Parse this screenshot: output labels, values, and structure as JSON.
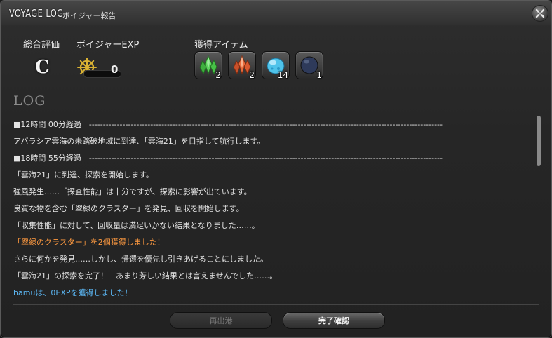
{
  "window": {
    "title": "VOYAGE LOG",
    "subtitle": "ボイジャー報告"
  },
  "summary": {
    "rating_label": "総合評価",
    "rating_value": "C",
    "exp_label": "ボイジャーEXP",
    "exp_value": "0",
    "exp_progress": 0,
    "items_label": "獲得アイテム"
  },
  "items": [
    {
      "icon": "green-crystal-cluster-icon",
      "count": "2"
    },
    {
      "icon": "fire-crystal-cluster-icon",
      "count": "2"
    },
    {
      "icon": "blue-orb-icon",
      "count": "14"
    },
    {
      "icon": "dark-sphere-icon",
      "count": "1"
    }
  ],
  "log": {
    "heading": "LOG",
    "lines": [
      {
        "text": "■12時間 00分経過　-------------------------------------------------------------------------------------------------------------------------------",
        "style": "normal"
      },
      {
        "text": "アバラシア雲海の未踏破地域に到達、「雲海21」を目指して航行します。",
        "style": "normal"
      },
      {
        "text": "■18時間 55分経過　-------------------------------------------------------------------------------------------------------------------------------",
        "style": "normal"
      },
      {
        "text": "「雲海21」に到達、探索を開始します。",
        "style": "normal"
      },
      {
        "text": "強風発生……「探査性能」は十分ですが、探索に影響が出ています。",
        "style": "normal"
      },
      {
        "text": "良質な物を含む「翠緑のクラスター」を発見、回収を開始します。",
        "style": "normal"
      },
      {
        "text": "「収集性能」に対して、回収量は満足いかない結果となりました……。",
        "style": "normal"
      },
      {
        "text": "「翠緑のクラスター」を2個獲得しました！",
        "style": "orange"
      },
      {
        "text": "さらに何かを発見……しかし、帰還を優先し引きあげることにしました。",
        "style": "normal"
      },
      {
        "text": "「雲海21」の探索を完了！　あまり芳しい結果とは言えませんでした……。",
        "style": "normal"
      },
      {
        "text": "hamuは、0EXPを獲得しました！",
        "style": "blue"
      }
    ]
  },
  "buttons": {
    "redeploy": "再出港",
    "finalize": "完了確認"
  },
  "colors": {
    "highlight_orange": "#ff9a40",
    "highlight_blue": "#5ab4f0"
  }
}
